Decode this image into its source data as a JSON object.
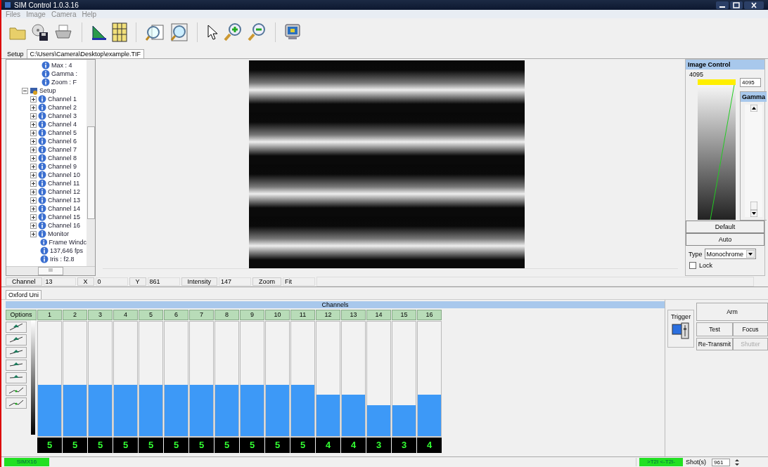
{
  "window": {
    "title": "SIM Control 1.0.3.16"
  },
  "menu": [
    "Files",
    "Image",
    "Camera",
    "Help"
  ],
  "tabs": [
    {
      "label": "Setup",
      "selected": false
    },
    {
      "label": "C:\\Users\\Camera\\Desktop\\example.TIF",
      "selected": true
    }
  ],
  "tree": [
    {
      "kind": "leaf",
      "label": "Max  : 4"
    },
    {
      "kind": "leaf",
      "label": "Gamma :"
    },
    {
      "kind": "leaf",
      "label": "Zoom : F"
    },
    {
      "kind": "node",
      "label": "Setup",
      "expanded": true,
      "children": [
        {
          "kind": "node",
          "label": "Channel 1",
          "expanded": false
        },
        {
          "kind": "node",
          "label": "Channel 2",
          "expanded": false
        },
        {
          "kind": "node",
          "label": "Channel 3",
          "expanded": false
        },
        {
          "kind": "node",
          "label": "Channel 4",
          "expanded": false
        },
        {
          "kind": "node",
          "label": "Channel 5",
          "expanded": false
        },
        {
          "kind": "node",
          "label": "Channel 6",
          "expanded": false
        },
        {
          "kind": "node",
          "label": "Channel 7",
          "expanded": false
        },
        {
          "kind": "node",
          "label": "Channel 8",
          "expanded": false
        },
        {
          "kind": "node",
          "label": "Channel 9",
          "expanded": false
        },
        {
          "kind": "node",
          "label": "Channel 10",
          "expanded": false
        },
        {
          "kind": "node",
          "label": "Channel 11",
          "expanded": false
        },
        {
          "kind": "node",
          "label": "Channel 12",
          "expanded": false
        },
        {
          "kind": "node",
          "label": "Channel 13",
          "expanded": false
        },
        {
          "kind": "node",
          "label": "Channel 14",
          "expanded": false
        },
        {
          "kind": "node",
          "label": "Channel 15",
          "expanded": false
        },
        {
          "kind": "node",
          "label": "Channel 16",
          "expanded": false
        },
        {
          "kind": "node",
          "label": "Monitor",
          "expanded": false
        },
        {
          "kind": "leaf",
          "label": "Frame Windc"
        },
        {
          "kind": "leaf",
          "label": "137,646 fps"
        },
        {
          "kind": "leaf",
          "label": "Iris : f2.8"
        }
      ]
    }
  ],
  "tree_scroll_label": "III",
  "image_control": {
    "title": "Image Control",
    "max_label": "4095",
    "max_value": "4095",
    "gamma_title": "Gamma",
    "buttons": [
      "Default",
      "Auto"
    ],
    "type_label": "Type",
    "type_value": "Monochrome",
    "lock": {
      "label": "Lock",
      "checked": false
    }
  },
  "readouts": [
    {
      "label": "Channel",
      "value": "13"
    },
    {
      "label": "X",
      "value": "0"
    },
    {
      "label": "Y",
      "value": "861"
    },
    {
      "label": "Intensity",
      "value": "147"
    },
    {
      "label": "Zoom",
      "value": "Fit"
    }
  ],
  "bottom_tab": "Oxford Uni",
  "channels_title": "Channels",
  "options_label": "Options",
  "channels": [
    {
      "name": "1",
      "level": 0.45,
      "reading": "5"
    },
    {
      "name": "2",
      "level": 0.45,
      "reading": "5"
    },
    {
      "name": "3",
      "level": 0.45,
      "reading": "5"
    },
    {
      "name": "4",
      "level": 0.45,
      "reading": "5"
    },
    {
      "name": "5",
      "level": 0.45,
      "reading": "5"
    },
    {
      "name": "6",
      "level": 0.45,
      "reading": "5"
    },
    {
      "name": "7",
      "level": 0.45,
      "reading": "5"
    },
    {
      "name": "8",
      "level": 0.45,
      "reading": "5"
    },
    {
      "name": "9",
      "level": 0.45,
      "reading": "5"
    },
    {
      "name": "10",
      "level": 0.45,
      "reading": "5"
    },
    {
      "name": "11",
      "level": 0.45,
      "reading": "5"
    },
    {
      "name": "12",
      "level": 0.36,
      "reading": "4"
    },
    {
      "name": "13",
      "level": 0.36,
      "reading": "4"
    },
    {
      "name": "14",
      "level": 0.27,
      "reading": "3"
    },
    {
      "name": "15",
      "level": 0.27,
      "reading": "3"
    },
    {
      "name": "16",
      "level": 0.36,
      "reading": "4"
    }
  ],
  "trigger_label": "Trigger",
  "controls": [
    {
      "label": "Arm",
      "disabled": false
    },
    {
      "label": "Test",
      "disabled": false
    },
    {
      "label": "Focus",
      "disabled": false
    },
    {
      "label": "Re-Transmit",
      "disabled": false
    },
    {
      "label": "Shutter",
      "disabled": true
    }
  ],
  "status_bar": {
    "camera": "SIMX16",
    "link": ">T2I <-T2I-",
    "shots_label": "Shot(s)",
    "shots_value": "961"
  }
}
